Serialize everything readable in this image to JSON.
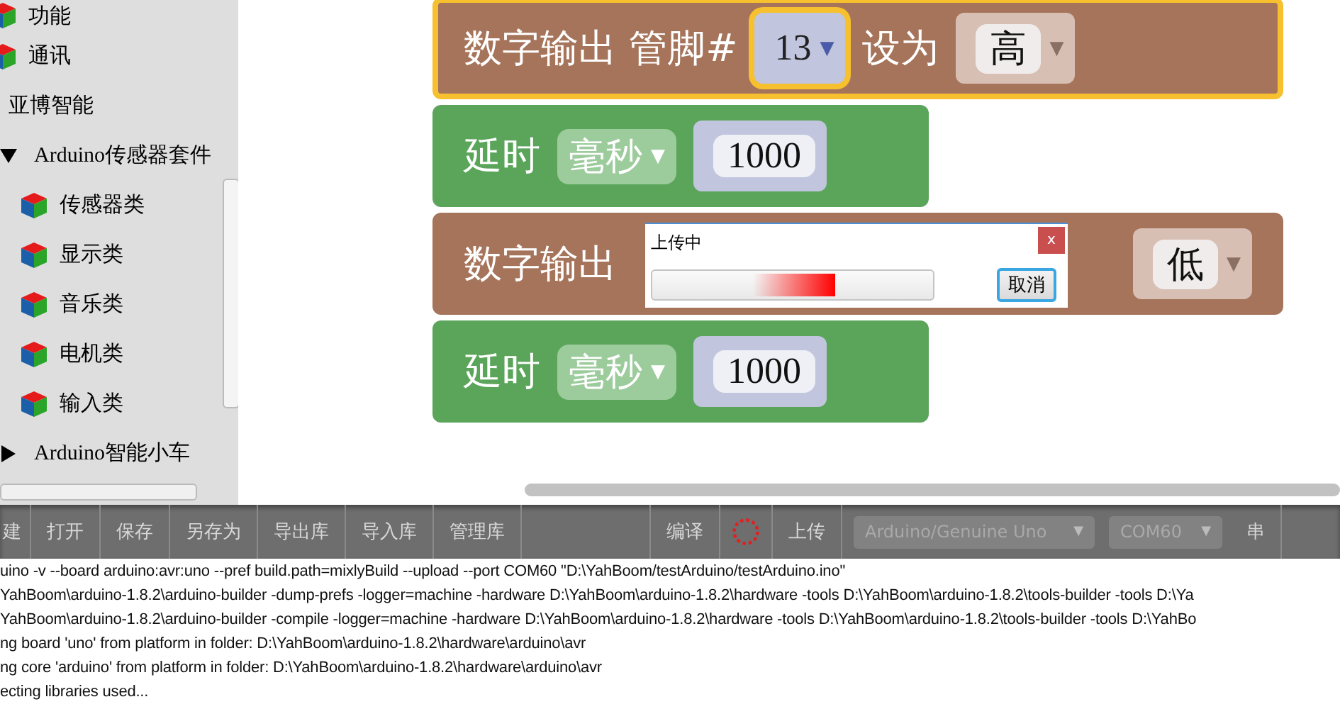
{
  "sidebar": {
    "items": [
      {
        "label": "功能",
        "kind": "category"
      },
      {
        "label": "通讯",
        "kind": "category"
      },
      {
        "label": "亚博智能",
        "kind": "group"
      },
      {
        "label": "Arduino传感器套件",
        "kind": "folder",
        "expanded": true,
        "children": [
          {
            "label": "传感器类",
            "kind": "category"
          },
          {
            "label": "显示类",
            "kind": "category"
          },
          {
            "label": "音乐类",
            "kind": "category"
          },
          {
            "label": "电机类",
            "kind": "category"
          },
          {
            "label": "输入类",
            "kind": "category"
          }
        ]
      },
      {
        "label": "Arduino智能小车",
        "kind": "folder",
        "expanded": false
      }
    ]
  },
  "blocks": [
    {
      "kind": "digital_write",
      "selected": true,
      "label": "数字输出 管脚#",
      "pin": "13",
      "pin_caret": "▼",
      "set_label": "设为",
      "value": "高",
      "value_caret": "▼"
    },
    {
      "kind": "delay",
      "selected": false,
      "label": "延时",
      "unit": "毫秒",
      "unit_caret": "▼",
      "value": "1000"
    },
    {
      "kind": "digital_write",
      "selected": false,
      "label": "数字输出",
      "value": "低",
      "value_caret": "▼"
    },
    {
      "kind": "delay",
      "selected": false,
      "label": "延时",
      "unit": "毫秒",
      "unit_caret": "▼",
      "value": "1000"
    }
  ],
  "dialog": {
    "title": "上传中",
    "close": "x",
    "cancel": "取消",
    "level": 0.65
  },
  "toolbar": {
    "items": [
      {
        "kind": "button",
        "label": "建"
      },
      {
        "kind": "button",
        "label": "打开"
      },
      {
        "kind": "button",
        "label": "保存"
      },
      {
        "kind": "button",
        "label": "另存为"
      },
      {
        "kind": "button",
        "label": "导出库"
      },
      {
        "kind": "button",
        "label": "导入库"
      },
      {
        "kind": "button",
        "label": "管理库"
      },
      {
        "kind": "gap"
      },
      {
        "kind": "button",
        "label": "编译"
      },
      {
        "kind": "spinner"
      },
      {
        "kind": "button",
        "label": "上传"
      },
      {
        "kind": "select",
        "label": "Arduino/Genuine Uno",
        "caret": "▼"
      },
      {
        "kind": "select",
        "label": "COM60",
        "caret": "▼"
      },
      {
        "kind": "button",
        "label": "串"
      }
    ]
  },
  "console": {
    "lines": [
      "uino -v --board arduino:avr:uno --pref build.path=mixlyBuild --upload --port COM60 \"D:\\YahBoom/testArduino/testArduino.ino\"",
      "YahBoom\\arduino-1.8.2\\arduino-builder -dump-prefs -logger=machine -hardware D:\\YahBoom\\arduino-1.8.2\\hardware -tools D:\\YahBoom\\arduino-1.8.2\\tools-builder -tools D:\\Ya",
      "YahBoom\\arduino-1.8.2\\arduino-builder -compile -logger=machine -hardware D:\\YahBoom\\arduino-1.8.2\\hardware -tools D:\\YahBoom\\arduino-1.8.2\\tools-builder -tools D:\\YahBo",
      "ng board 'uno' from platform in folder: D:\\YahBoom\\arduino-1.8.2\\hardware\\arduino\\avr",
      "ng core 'arduino' from platform in folder: D:\\YahBoom\\arduino-1.8.2\\hardware\\arduino\\avr",
      "ecting libraries used..."
    ]
  }
}
